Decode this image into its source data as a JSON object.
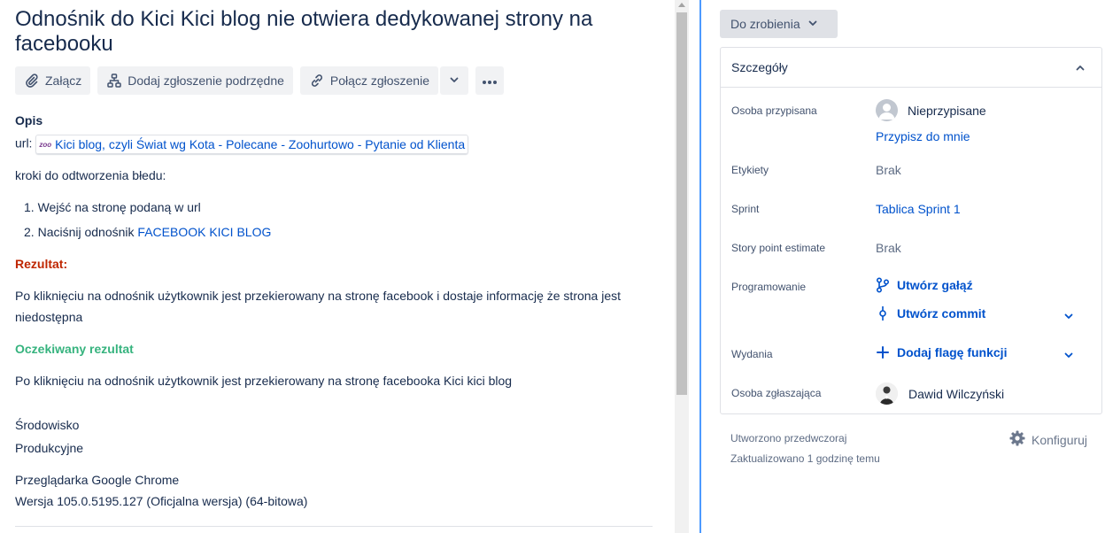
{
  "issue": {
    "title": "Odnośnik do Kici Kici blog nie otwiera dedykowanej strony na facebooku"
  },
  "toolbar": {
    "attach_label": "Załącz",
    "add_child_label": "Dodaj zgłoszenie podrzędne",
    "link_issue_label": "Połącz zgłoszenie"
  },
  "description": {
    "heading": "Opis",
    "url_prefix": "url:",
    "url_badge": "zoo",
    "url_title": "Kici blog, czyli Świat wg Kota - Polecane - Zoohurtowo - Pytanie od Klienta",
    "steps_intro": "kroki do odtworzenia błedu:",
    "step1_num": "1.",
    "step1": "Wejść na stronę podaną w url",
    "step2_num": "2.",
    "step2_text": "Naciśnij odnośnik",
    "step2_link": "FACEBOOK KICI BLOG",
    "result_heading": "Rezultat:",
    "result_line1": "Po kliknięciu na odnośnik użytkownik jest przekierowany na stronę facebook i dostaje informację że strona jest",
    "result_line2": "niedostępna",
    "expected_heading": "Oczekiwany rezultat",
    "expected_text": "Po kliknięciu na odnośnik użytkownik jest przekierowany na stronę facebooka Kici kici blog",
    "env_heading": "Środowisko",
    "env_value": "Produkcyjne",
    "browser_line1": "Przeglądarka Google Chrome",
    "browser_line2": "Wersja 105.0.5195.127 (Oficjalna wersja) (64-bitowa)"
  },
  "status": {
    "label": "Do zrobienia"
  },
  "details": {
    "title": "Szczegóły",
    "assignee_label": "Osoba przypisana",
    "assignee_value": "Nieprzypisane",
    "assign_to_me": "Przypisz do mnie",
    "labels_label": "Etykiety",
    "labels_value": "Brak",
    "sprint_label": "Sprint",
    "sprint_value": "Tablica Sprint 1",
    "story_points_label": "Story point estimate",
    "story_points_value": "Brak",
    "development_label": "Programowanie",
    "create_branch": "Utwórz gałąź",
    "create_commit": "Utwórz commit",
    "releases_label": "Wydania",
    "add_feature_flag": "Dodaj flagę funkcji",
    "reporter_label": "Osoba zgłaszająca",
    "reporter_value": "Dawid Wilczyński"
  },
  "meta": {
    "created": "Utworzono przedwczoraj",
    "updated": "Zaktualizowano 1 godzinę temu",
    "configure": "Konfiguruj"
  },
  "colors": {
    "link": "#0052cc",
    "result_red": "#bf2600",
    "expected_green": "#36b37e",
    "focus_line": "#4c9aff"
  }
}
